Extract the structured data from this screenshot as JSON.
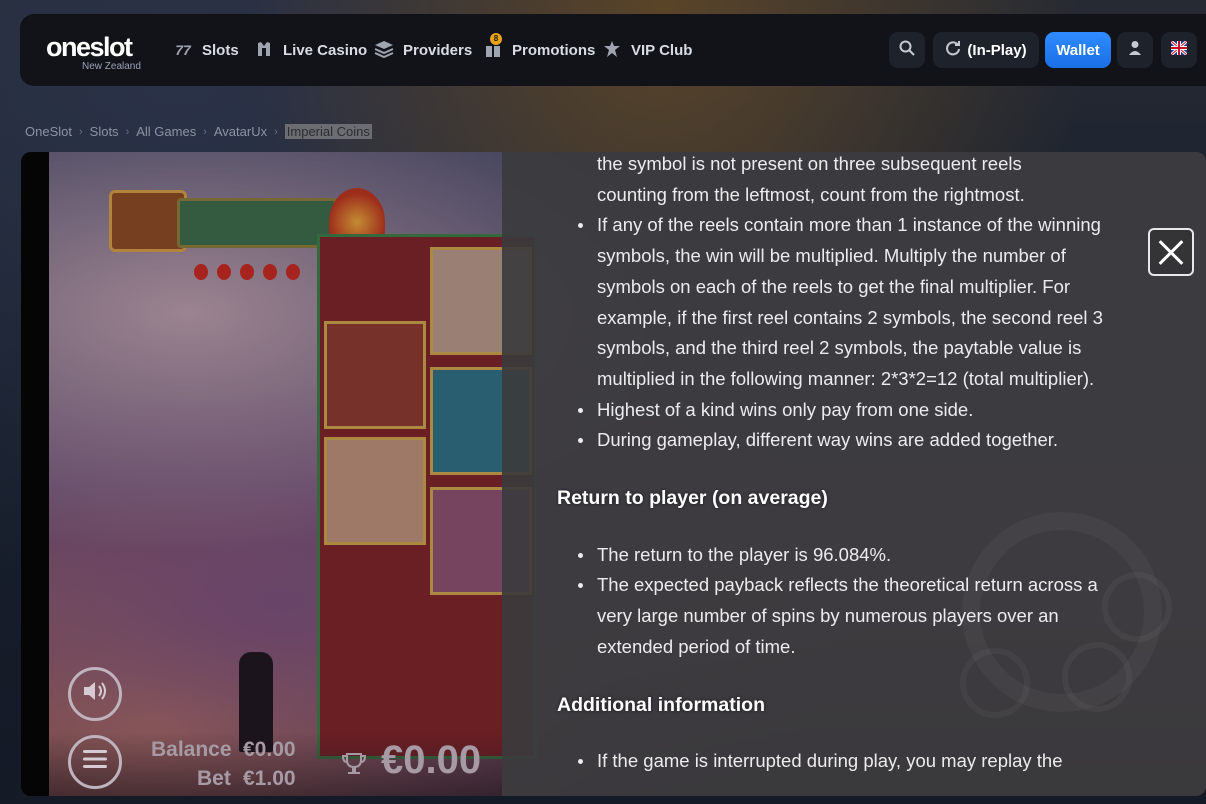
{
  "nav": {
    "logo": "oneslot",
    "logo_sub": "New Zealand",
    "items": [
      {
        "label": "Slots",
        "icon": "slots-777-icon"
      },
      {
        "label": "Live Casino",
        "icon": "live-casino-icon"
      },
      {
        "label": "Providers",
        "icon": "providers-stack-icon"
      },
      {
        "label": "Promotions",
        "icon": "gift-icon",
        "badge": "8"
      },
      {
        "label": "VIP Club",
        "icon": "crown-icon"
      }
    ],
    "inplay_label": "(In-Play)",
    "wallet_label": "Wallet",
    "accent": "#2f8cff"
  },
  "breadcrumb": [
    "OneSlot",
    "Slots",
    "All Games",
    "AvatarUx",
    "Imperial Coins"
  ],
  "game": {
    "balance_label": "Balance",
    "balance_value": "€0.00",
    "bet_label": "Bet",
    "bet_value": "€1.00",
    "win_value": "€0.00"
  },
  "info": {
    "continuation_1": "the symbol is not present on three subsequent reels",
    "continuation_2": "counting from the leftmost, count from the rightmost.",
    "bullets_1": [
      "If any of the reels contain more than 1 instance of the winning symbols, the win will be multiplied. Multiply the number of symbols on each of the reels to get the final multiplier. For example, if the first reel contains 2 symbols, the second reel 3 symbols, and the third reel 2 symbols, the paytable value is multiplied in the following manner: 2*3*2=12 (total multiplier).",
      "Highest of a kind wins only pay from one side.",
      "During gameplay, different way wins are added together."
    ],
    "heading_rtp": "Return to player (on average)",
    "bullets_rtp": [
      "The return to the player is 96.084%.",
      "The expected payback reflects the theoretical return across a very large number of spins by numerous players over an extended period of time."
    ],
    "heading_additional": "Additional information",
    "bullets_additional": [
      "If the game is interrupted during play, you may replay the"
    ]
  }
}
